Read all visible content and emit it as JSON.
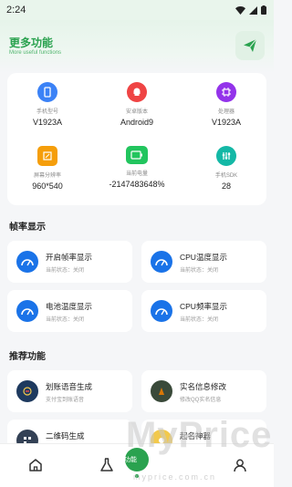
{
  "status_bar": {
    "time": "2:24"
  },
  "header": {
    "title": "更多功能",
    "subtitle": "More useful functions"
  },
  "device_info": [
    {
      "label": "手机型号",
      "value": "V1923A",
      "icon": "phone-icon",
      "color": "#3b82f6"
    },
    {
      "label": "安卓版本",
      "value": "Android9",
      "icon": "android-icon",
      "color": "#ef4444"
    },
    {
      "label": "处理器",
      "value": "V1923A",
      "icon": "chip-icon",
      "color": "#9333ea"
    },
    {
      "label": "屏幕分辨率",
      "value": "960*540",
      "icon": "screen-icon",
      "color": "#f59e0b"
    },
    {
      "label": "当前电量",
      "value": "-2147483648%",
      "icon": "battery-icon",
      "color": "#22c55e"
    },
    {
      "label": "手机SDK",
      "value": "28",
      "icon": "sdk-icon",
      "color": "#14b8a6"
    }
  ],
  "sections": {
    "frame_title": "帧率显示",
    "recommend_title": "推荐功能"
  },
  "frame_tiles": [
    {
      "title": "开启帧率显示",
      "subtitle": "当前状态：关闭"
    },
    {
      "title": "CPU温度显示",
      "subtitle": "当前状态：关闭"
    },
    {
      "title": "电池温度显示",
      "subtitle": "当前状态：关闭"
    },
    {
      "title": "CPU频率显示",
      "subtitle": "当前状态：关闭"
    }
  ],
  "recommend_tiles": [
    {
      "title": "划账语音生成",
      "subtitle": "支付宝到账语音",
      "icon": "voice-icon",
      "color": "#1e3a5f"
    },
    {
      "title": "实名信息修改",
      "subtitle": "修改QQ实名信息",
      "icon": "id-icon",
      "color": "#3a4a3a"
    },
    {
      "title": "二维码生成",
      "subtitle": "",
      "icon": "qrcode-icon",
      "color": "#334155"
    },
    {
      "title": "起名神器",
      "subtitle": "",
      "icon": "name-icon",
      "color": "#f2c94c"
    }
  ],
  "tab_bar": {
    "active_label": "功能"
  },
  "watermark": {
    "text": "MyPrice",
    "sub": "myprice.com.cn"
  },
  "accent": "#2aa24f"
}
